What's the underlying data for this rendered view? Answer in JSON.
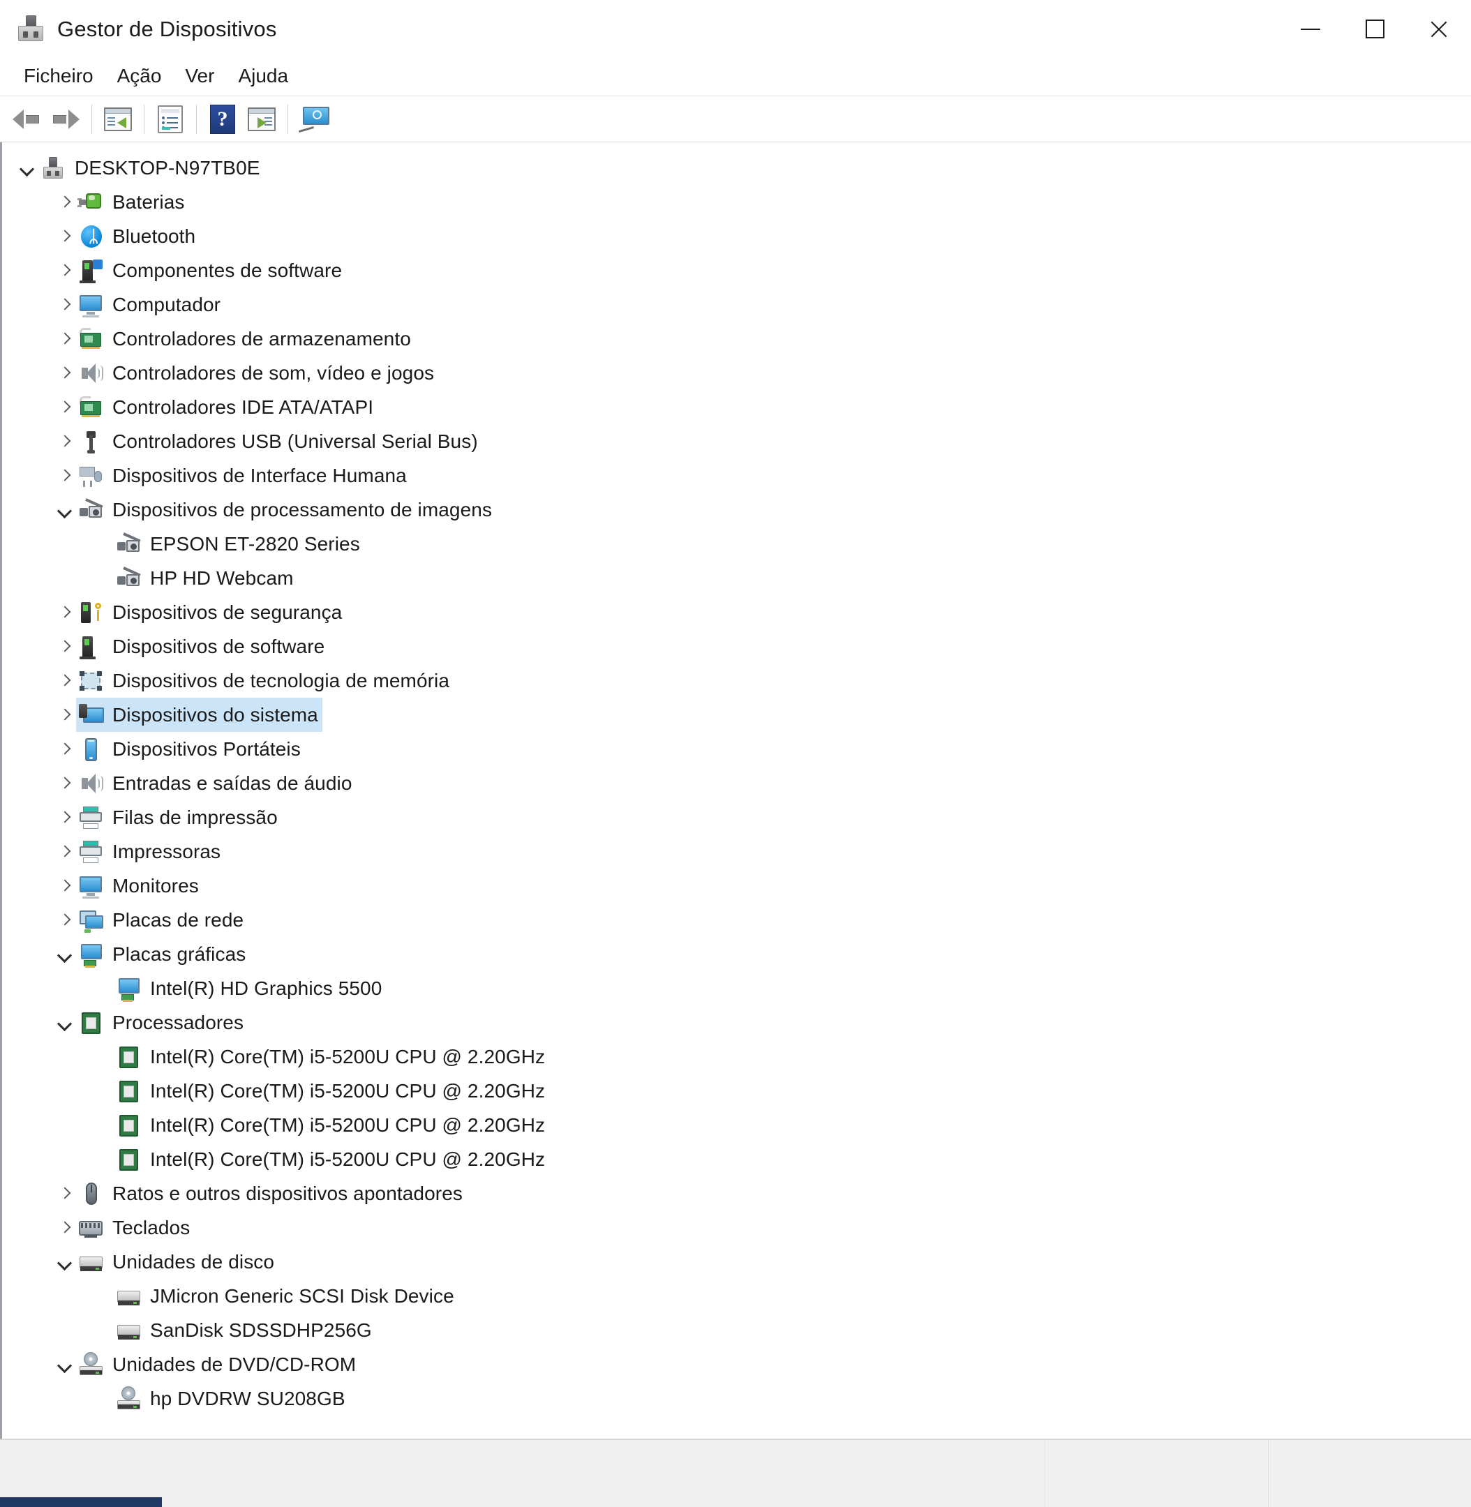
{
  "window": {
    "title": "Gestor de Dispositivos",
    "icon": "device-manager-icon",
    "controls": {
      "minimize": "—",
      "maximize": "☐",
      "close": "✕"
    }
  },
  "menubar": {
    "items": [
      {
        "label": "Ficheiro",
        "name": "menu-ficheiro"
      },
      {
        "label": "Ação",
        "name": "menu-acao"
      },
      {
        "label": "Ver",
        "name": "menu-ver"
      },
      {
        "label": "Ajuda",
        "name": "menu-ajuda"
      }
    ]
  },
  "toolbar": {
    "buttons": [
      {
        "name": "back-button",
        "icon": "arrow-left-icon"
      },
      {
        "name": "forward-button",
        "icon": "arrow-right-icon"
      },
      {
        "name": "show-hide-console-tree-button",
        "icon": "console-tree-icon"
      },
      {
        "name": "properties-button",
        "icon": "properties-icon"
      },
      {
        "name": "help-button",
        "icon": "help-question-icon"
      },
      {
        "name": "show-hide-action-pane-button",
        "icon": "action-pane-icon"
      },
      {
        "name": "scan-for-hardware-changes-button",
        "icon": "scan-hardware-icon"
      }
    ]
  },
  "tree": {
    "root": {
      "label": "DESKTOP-N97TB0E",
      "icon": "computer-root-icon",
      "expanded": true
    },
    "items": [
      {
        "label": "Baterias",
        "icon": "battery-icon",
        "state": "collapsed",
        "depth": 1
      },
      {
        "label": "Bluetooth",
        "icon": "bluetooth-icon",
        "state": "collapsed",
        "depth": 1
      },
      {
        "label": "Componentes de software",
        "icon": "software-component-icon",
        "state": "collapsed",
        "depth": 1
      },
      {
        "label": "Computador",
        "icon": "monitor-icon",
        "state": "collapsed",
        "depth": 1
      },
      {
        "label": "Controladores de armazenamento",
        "icon": "storage-controller-icon",
        "state": "collapsed",
        "depth": 1
      },
      {
        "label": "Controladores de som, vídeo e jogos",
        "icon": "speaker-icon",
        "state": "collapsed",
        "depth": 1
      },
      {
        "label": "Controladores IDE ATA/ATAPI",
        "icon": "ide-controller-icon",
        "state": "collapsed",
        "depth": 1
      },
      {
        "label": "Controladores USB (Universal Serial Bus)",
        "icon": "usb-icon",
        "state": "collapsed",
        "depth": 1
      },
      {
        "label": "Dispositivos de Interface Humana",
        "icon": "hid-icon",
        "state": "collapsed",
        "depth": 1
      },
      {
        "label": "Dispositivos de processamento de imagens",
        "icon": "imaging-device-icon",
        "state": "expanded",
        "depth": 1
      },
      {
        "label": "EPSON ET-2820 Series",
        "icon": "imaging-device-icon",
        "state": "leaf",
        "depth": 2
      },
      {
        "label": "HP HD Webcam",
        "icon": "imaging-device-icon",
        "state": "leaf",
        "depth": 2
      },
      {
        "label": "Dispositivos de segurança",
        "icon": "security-device-icon",
        "state": "collapsed",
        "depth": 1
      },
      {
        "label": "Dispositivos de software",
        "icon": "software-device-icon",
        "state": "collapsed",
        "depth": 1
      },
      {
        "label": "Dispositivos de tecnologia de memória",
        "icon": "memory-technology-icon",
        "state": "collapsed",
        "depth": 1
      },
      {
        "label": "Dispositivos do sistema",
        "icon": "system-device-icon",
        "state": "collapsed",
        "depth": 1,
        "selected": true
      },
      {
        "label": "Dispositivos Portáteis",
        "icon": "portable-device-icon",
        "state": "collapsed",
        "depth": 1
      },
      {
        "label": "Entradas e saídas de áudio",
        "icon": "speaker-icon",
        "state": "collapsed",
        "depth": 1
      },
      {
        "label": "Filas de impressão",
        "icon": "printer-icon",
        "state": "collapsed",
        "depth": 1
      },
      {
        "label": "Impressoras",
        "icon": "printer-icon",
        "state": "collapsed",
        "depth": 1
      },
      {
        "label": "Monitores",
        "icon": "monitor-icon",
        "state": "collapsed",
        "depth": 1
      },
      {
        "label": "Placas de rede",
        "icon": "network-adapter-icon",
        "state": "collapsed",
        "depth": 1
      },
      {
        "label": "Placas gráficas",
        "icon": "display-adapter-icon",
        "state": "expanded",
        "depth": 1
      },
      {
        "label": "Intel(R) HD Graphics 5500",
        "icon": "display-adapter-icon",
        "state": "leaf",
        "depth": 2
      },
      {
        "label": "Processadores",
        "icon": "processor-icon",
        "state": "expanded",
        "depth": 1
      },
      {
        "label": "Intel(R) Core(TM) i5-5200U CPU @ 2.20GHz",
        "icon": "processor-icon",
        "state": "leaf",
        "depth": 2
      },
      {
        "label": "Intel(R) Core(TM) i5-5200U CPU @ 2.20GHz",
        "icon": "processor-icon",
        "state": "leaf",
        "depth": 2
      },
      {
        "label": "Intel(R) Core(TM) i5-5200U CPU @ 2.20GHz",
        "icon": "processor-icon",
        "state": "leaf",
        "depth": 2
      },
      {
        "label": "Intel(R) Core(TM) i5-5200U CPU @ 2.20GHz",
        "icon": "processor-icon",
        "state": "leaf",
        "depth": 2
      },
      {
        "label": "Ratos e outros dispositivos apontadores",
        "icon": "mouse-icon",
        "state": "collapsed",
        "depth": 1
      },
      {
        "label": "Teclados",
        "icon": "keyboard-icon",
        "state": "collapsed",
        "depth": 1
      },
      {
        "label": "Unidades de disco",
        "icon": "disk-drive-icon",
        "state": "expanded",
        "depth": 1
      },
      {
        "label": "JMicron Generic SCSI Disk Device",
        "icon": "disk-drive-icon",
        "state": "leaf",
        "depth": 2
      },
      {
        "label": "SanDisk SDSSDHP256G",
        "icon": "disk-drive-icon",
        "state": "leaf",
        "depth": 2
      },
      {
        "label": "Unidades de DVD/CD-ROM",
        "icon": "dvd-drive-icon",
        "state": "expanded",
        "depth": 1
      },
      {
        "label": "hp DVDRW  SU208GB",
        "icon": "dvd-drive-icon",
        "state": "leaf",
        "depth": 2
      }
    ]
  },
  "statusbar": {
    "main_text": "",
    "pane2_text": "",
    "pane3_text": ""
  },
  "colors": {
    "selection": "#cce4f7",
    "window_bg": "#ffffff",
    "statusbar_bg": "#f0f0f0",
    "text": "#1a1a1a"
  }
}
